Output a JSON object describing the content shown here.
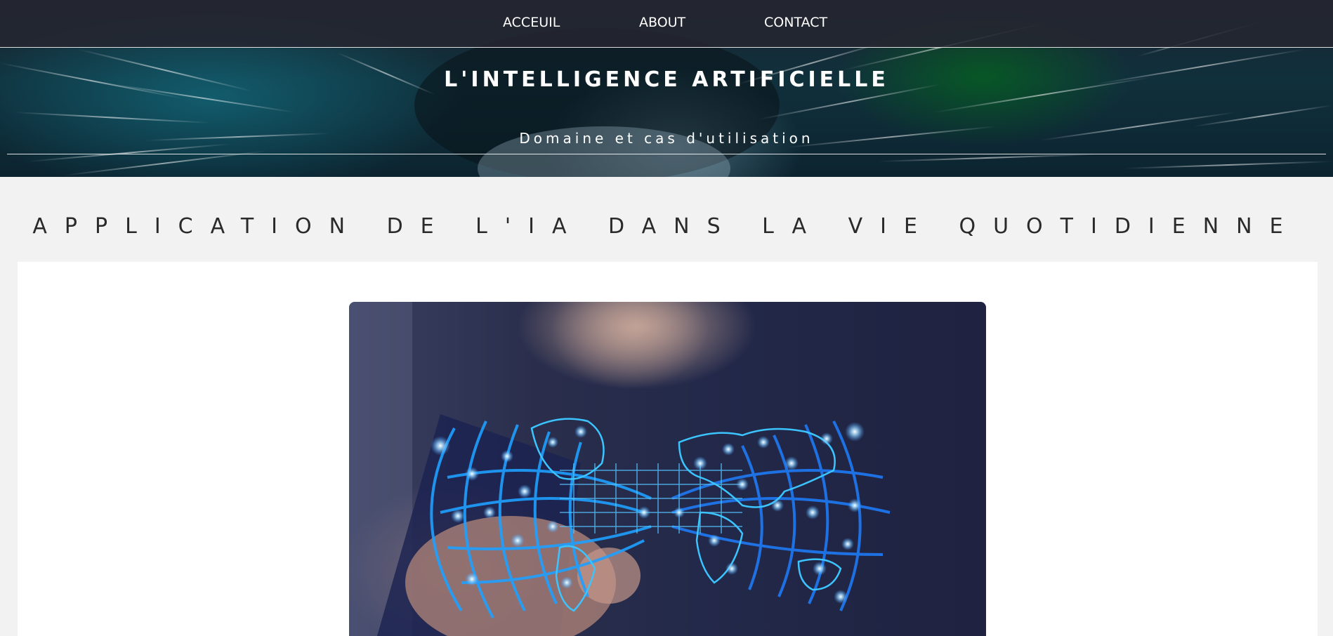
{
  "nav": {
    "items": [
      {
        "label": "ACCEUIL"
      },
      {
        "label": "ABOUT"
      },
      {
        "label": "CONTACT"
      }
    ]
  },
  "hero": {
    "title": "L'INTELLIGENCE ARTIFICIELLE",
    "subtitle": "Domaine et cas d'utilisation"
  },
  "section": {
    "title": "APPLICATION DE L'IA DANS LA VIE QUOTIDIENNE"
  },
  "image": {
    "subject": "hand-touching-world-map-network"
  },
  "colors": {
    "nav_bg": "#242630",
    "page_bg": "#f2f2f2",
    "card_bg": "#ffffff",
    "title_text": "#2a2a2a",
    "hero_text": "#ffffff"
  }
}
